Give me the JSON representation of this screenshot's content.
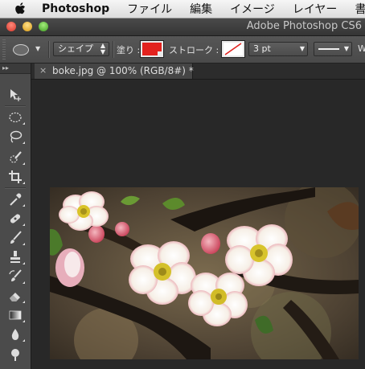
{
  "menubar": {
    "app_name": "Photoshop",
    "menus": [
      "ファイル",
      "編集",
      "イメージ",
      "レイヤー",
      "書式"
    ]
  },
  "window": {
    "title": "Adobe Photoshop CS6"
  },
  "options": {
    "shape_mode": "シェイプ",
    "fill_label": "塗り :",
    "fill_color": "#e2221e",
    "stroke_label": "ストローク :",
    "stroke_width": "3 pt",
    "next_label": "W"
  },
  "document": {
    "close_glyph": "×",
    "tab_title": "boke.jpg @ 100% (RGB/8#) *"
  },
  "toolbox": {
    "collapse_glyph": "▸▸",
    "tools": [
      "move-tool",
      "elliptical-marquee-tool",
      "lasso-tool",
      "quick-selection-tool",
      "crop-tool",
      "eyedropper-tool",
      "spot-healing-brush-tool",
      "brush-tool",
      "clone-stamp-tool",
      "history-brush-tool",
      "eraser-tool",
      "gradient-tool",
      "blur-tool",
      "dodge-tool"
    ]
  },
  "colors": {
    "accent_fill": "#e2221e",
    "workspace_bg": "#282828",
    "panel_bg": "#4b4b4b"
  }
}
